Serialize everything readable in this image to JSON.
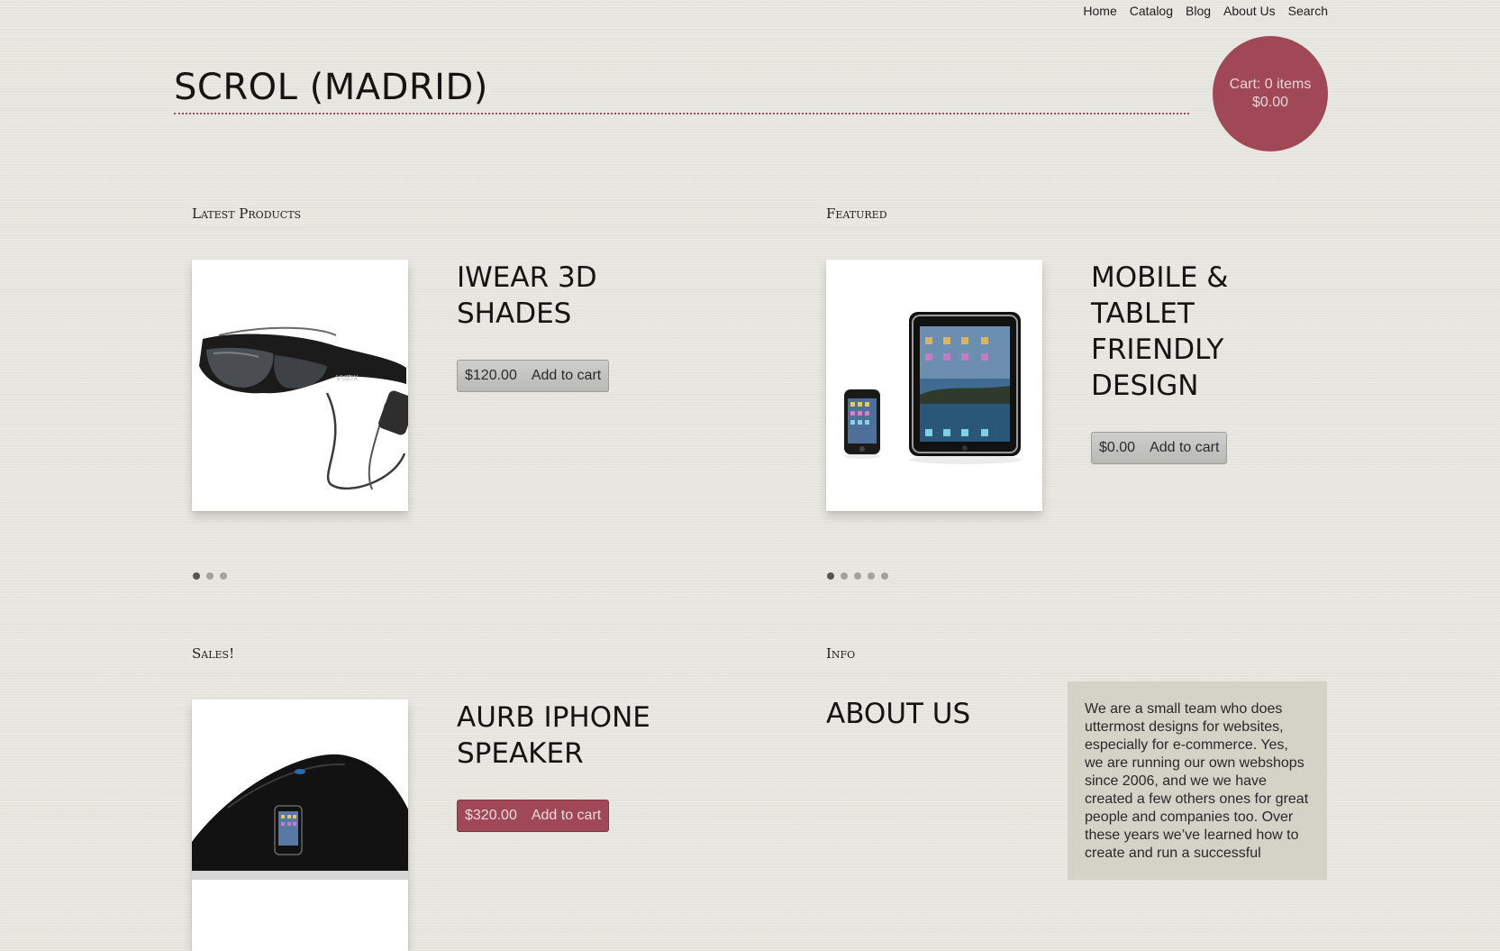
{
  "nav": {
    "items": [
      {
        "label": "Home"
      },
      {
        "label": "Catalog"
      },
      {
        "label": "Blog"
      },
      {
        "label": "About Us"
      },
      {
        "label": "Search"
      }
    ]
  },
  "header": {
    "site_title": "SCROL (MADRID)"
  },
  "cart": {
    "items_label": "Cart: 0 items",
    "total": "$0.00"
  },
  "latest": {
    "section_label": "Latest Products",
    "product": {
      "title": "iWear 3D Shades",
      "price": "$120.00",
      "add_label": "Add to cart",
      "image_icon": "video-glasses-icon"
    },
    "slides_count": 3,
    "active_slide": 1
  },
  "featured": {
    "section_label": "Featured",
    "product": {
      "title": "Mobile & Tablet Friendly Design",
      "price": "$0.00",
      "add_label": "Add to cart",
      "image_icon": "phone-and-tablet-icon"
    },
    "slides_count": 5,
    "active_slide": 1
  },
  "sales": {
    "section_label": "Sales!",
    "product": {
      "title": "Aurb iPhone Speaker",
      "price": "$320.00",
      "add_label": "Add to cart",
      "image_icon": "iphone-speaker-dock-icon"
    }
  },
  "info": {
    "section_label": "Info",
    "heading": "ABOUT US",
    "text": "We are a small team who does uttermost designs for websites, especially for e-commerce. Yes, we are running our own webshops since 2006, and we we have created a few others ones for great people and companies too. Over these years we’ve learned how to create and run a successful"
  },
  "colors": {
    "accent": "#a04858",
    "background": "#e6e5de",
    "info_box": "#d3d3c8"
  }
}
